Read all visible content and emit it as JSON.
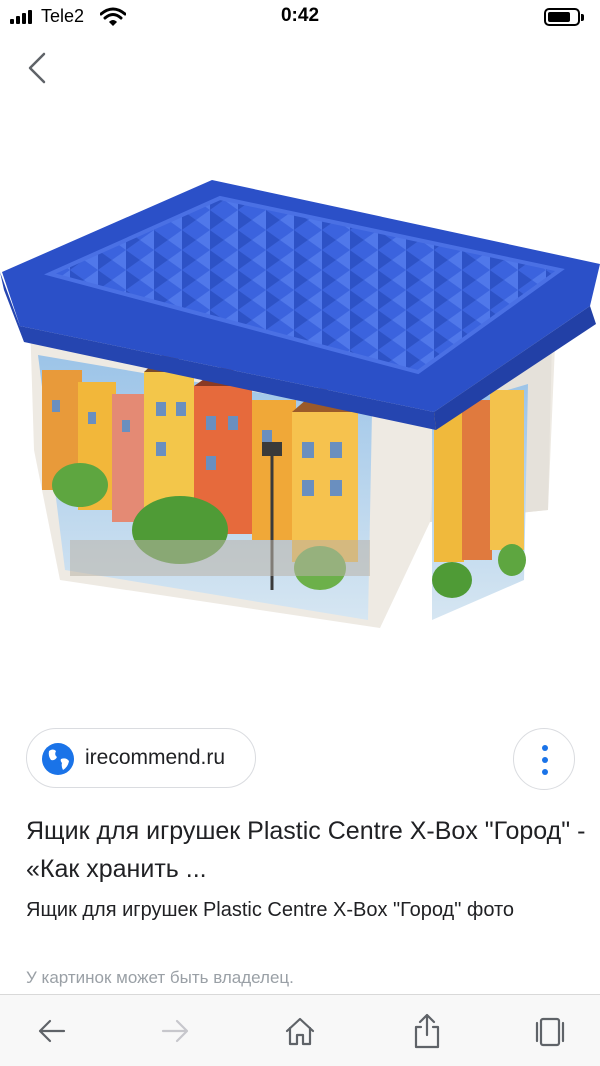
{
  "status_bar": {
    "carrier": "Tele2",
    "time": "0:42"
  },
  "source": {
    "site": "irecommend.ru"
  },
  "result": {
    "title": "Ящик для игрушек Plastic Centre X-Box \"Город\" - «Как хранить ...",
    "subtitle": "Ящик для игрушек Plastic Centre X-Box \"Город\" фото",
    "owner_note": "У картинок может быть владелец."
  },
  "colors": {
    "accent": "#1a73e8",
    "lid_blue": "#2f57d6",
    "toolbar_icon": "#007aff"
  },
  "icons": {
    "back": "chevron-left-icon",
    "site": "globe-icon",
    "more": "more-vertical-icon",
    "nav_back": "arrow-left-icon",
    "nav_forward": "arrow-right-icon",
    "home": "home-icon",
    "share": "share-icon",
    "tabs": "tabs-icon"
  }
}
